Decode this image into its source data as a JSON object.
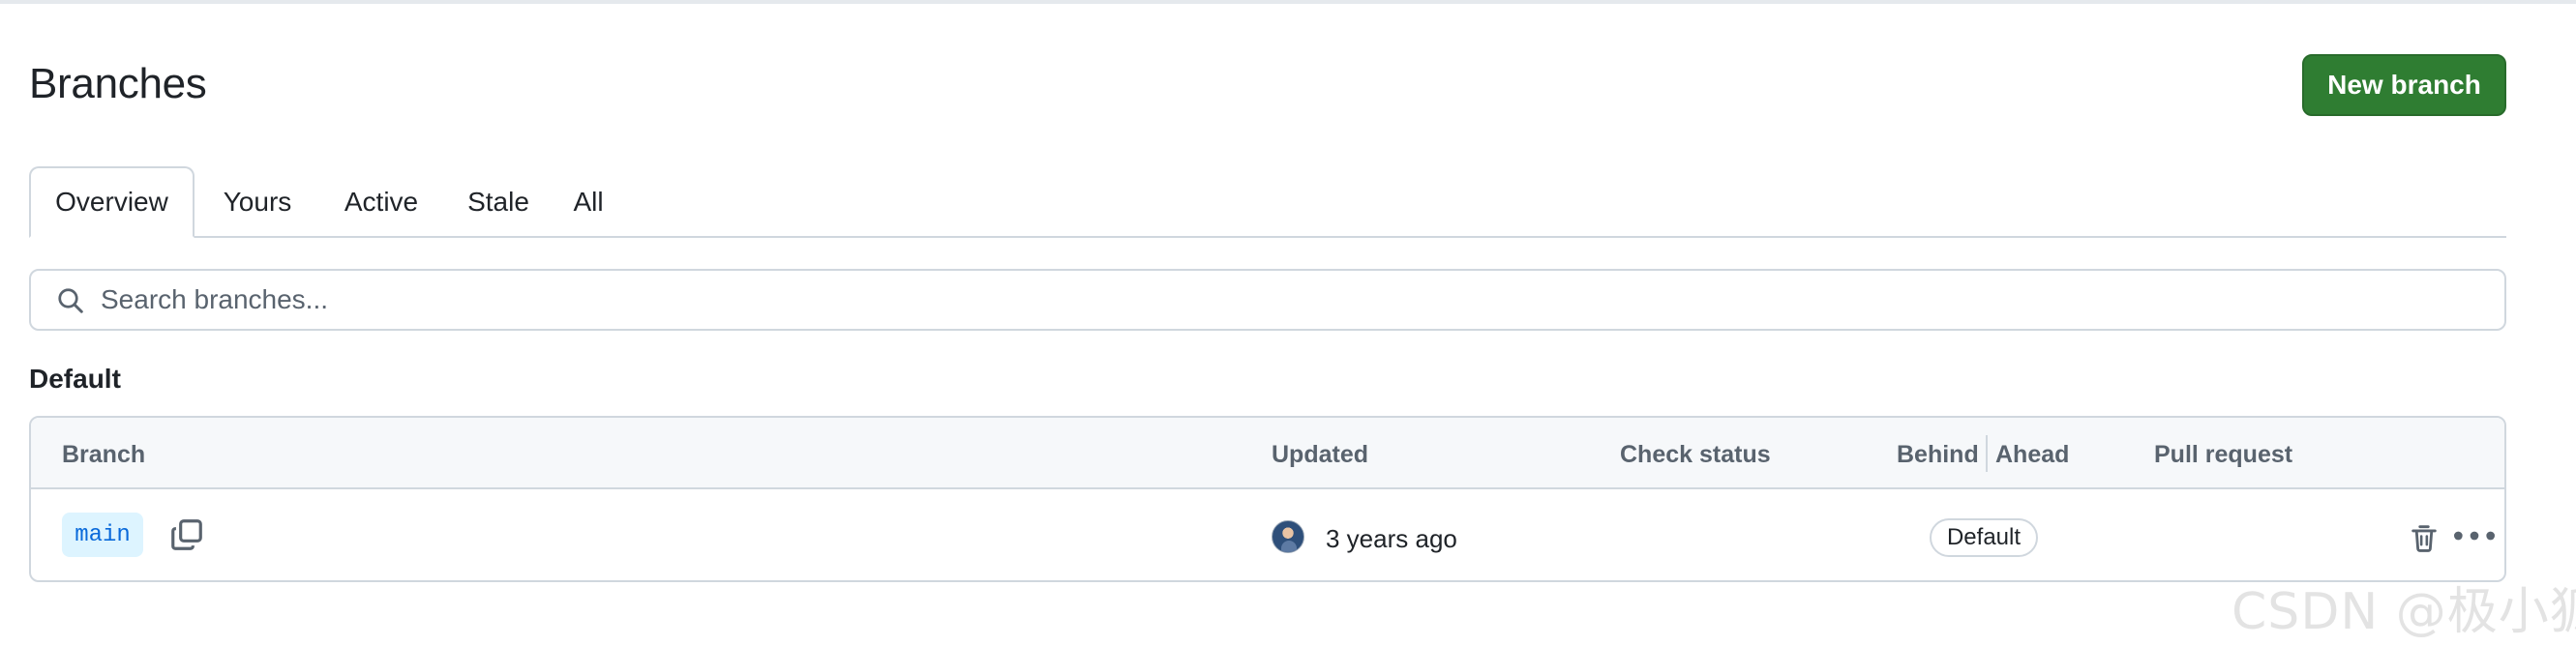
{
  "header": {
    "title": "Branches",
    "new_branch_label": "New branch"
  },
  "tabs": [
    {
      "label": "Overview",
      "selected": true
    },
    {
      "label": "Yours",
      "selected": false
    },
    {
      "label": "Active",
      "selected": false
    },
    {
      "label": "Stale",
      "selected": false
    },
    {
      "label": "All",
      "selected": false
    }
  ],
  "search": {
    "placeholder": "Search branches...",
    "value": "",
    "icon": "search-icon"
  },
  "section": {
    "heading": "Default",
    "columns": [
      "Branch",
      "Updated",
      "Check status",
      "Behind",
      "Ahead",
      "Pull request"
    ],
    "rows": [
      {
        "branch": "main",
        "updated": "3 years ago",
        "badge": "Default",
        "icons": [
          "copy-icon",
          "avatar",
          "trash-icon",
          "kebab-menu-icon"
        ]
      }
    ]
  },
  "colors": {
    "accent_green": "#2f7d32",
    "link_blue": "#0969da",
    "chip_bg": "#ddf4ff",
    "border": "#d0d7de"
  },
  "watermark": "CSDN @极小狐"
}
